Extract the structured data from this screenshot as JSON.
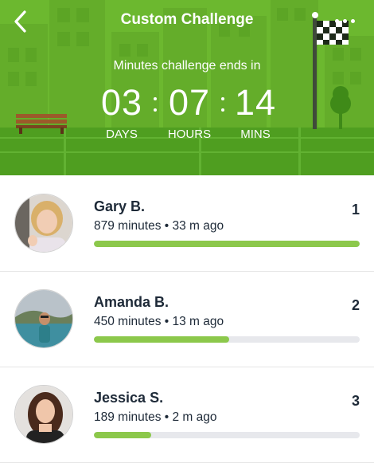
{
  "header": {
    "title": "Custom Challenge",
    "subtitle": "Minutes challenge ends in",
    "back_icon": "chevron-left-icon",
    "more_icon": "more-dots-icon",
    "countdown": [
      {
        "value": "03",
        "label": "DAYS"
      },
      {
        "value": "07",
        "label": "HOURS"
      },
      {
        "value": "14",
        "label": "MINS"
      }
    ],
    "colors": {
      "background": "#6cb82f",
      "text": "#ffffff"
    }
  },
  "leaderboard": [
    {
      "name": "Gary B.",
      "minutes": "879 minutes",
      "updated": "33 m ago",
      "rank": "1",
      "progress": 1.0
    },
    {
      "name": "Amanda B.",
      "minutes": "450 minutes",
      "updated": "13 m ago",
      "rank": "2",
      "progress": 0.51
    },
    {
      "name": "Jessica S.",
      "minutes": "189 minutes",
      "updated": "2 m ago",
      "rank": "3",
      "progress": 0.215
    }
  ],
  "colors": {
    "progress_fill": "#8cc84b",
    "progress_track": "#e7e8ec",
    "text_dark": "#1e2a38"
  }
}
